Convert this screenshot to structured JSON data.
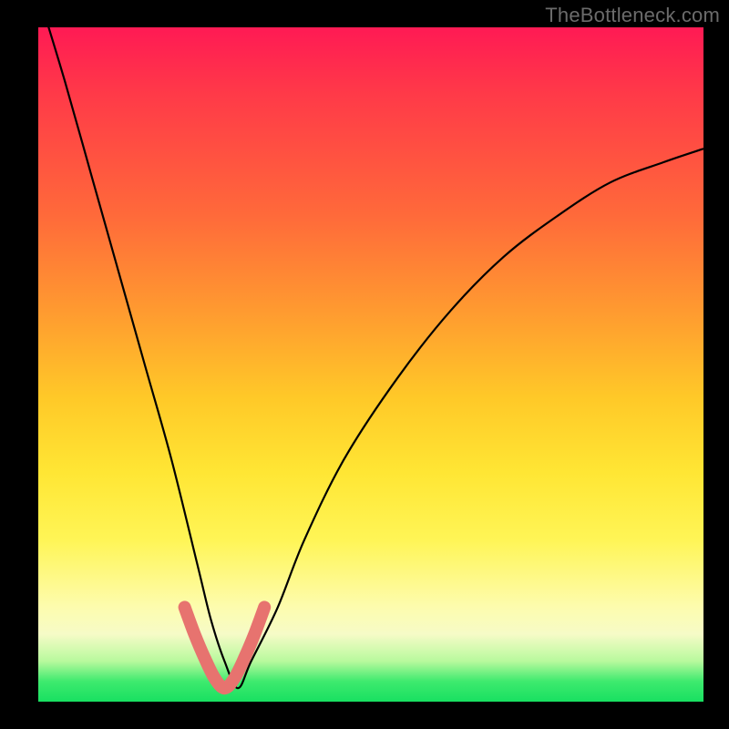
{
  "watermark": "TheBottleneck.com",
  "chart_data": {
    "type": "line",
    "title": "",
    "xlabel": "",
    "ylabel": "",
    "xlim": [
      0,
      100
    ],
    "ylim": [
      0,
      100
    ],
    "grid": false,
    "legend": false,
    "series": [
      {
        "name": "bottleneck_curve",
        "x": [
          0,
          4,
          8,
          12,
          16,
          20,
          24,
          26,
          28,
          30,
          32,
          36,
          40,
          46,
          54,
          62,
          70,
          78,
          86,
          94,
          100
        ],
        "y": [
          105,
          92,
          78,
          64,
          50,
          36,
          20,
          12,
          6,
          2,
          6,
          14,
          24,
          36,
          48,
          58,
          66,
          72,
          77,
          80,
          82
        ]
      },
      {
        "name": "optimal_region",
        "x": [
          22,
          23.5,
          25,
          26.5,
          28,
          29.5,
          31,
          32.5,
          34
        ],
        "y": [
          14,
          10,
          6.5,
          3.5,
          2,
          3.5,
          6.5,
          10,
          14
        ]
      }
    ],
    "background_gradient": {
      "stops": [
        {
          "pos": 0.0,
          "color": "#ff1a54"
        },
        {
          "pos": 0.28,
          "color": "#ff6a3a"
        },
        {
          "pos": 0.55,
          "color": "#ffc928"
        },
        {
          "pos": 0.76,
          "color": "#fff556"
        },
        {
          "pos": 0.9,
          "color": "#f6fbc7"
        },
        {
          "pos": 0.97,
          "color": "#3eea6e"
        },
        {
          "pos": 1.0,
          "color": "#18e061"
        }
      ]
    }
  }
}
